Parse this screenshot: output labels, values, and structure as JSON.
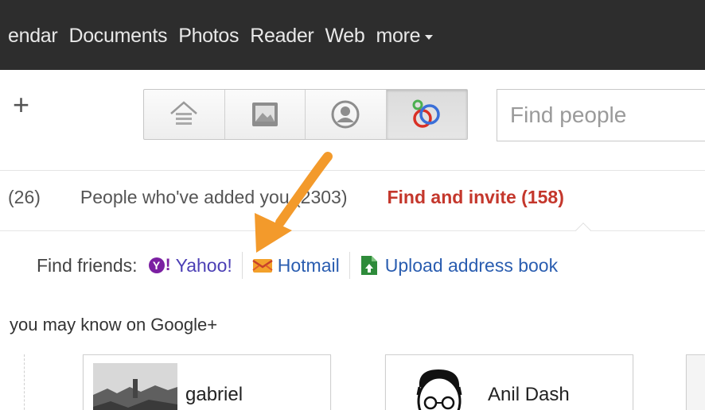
{
  "topnav": {
    "items": [
      "endar",
      "Documents",
      "Photos",
      "Reader",
      "Web"
    ],
    "more_label": "more"
  },
  "toolbar": {
    "plus_label": "+",
    "icons": [
      "home-icon",
      "photos-icon",
      "profile-icon",
      "circles-icon"
    ],
    "active_icon": "circles-icon",
    "search_placeholder": "Find people"
  },
  "tabs": {
    "partial_count": "(26)",
    "people_added": "People who've added you (2303)",
    "find_invite": "Find and invite (158)"
  },
  "find_friends": {
    "label": "Find friends:",
    "yahoo": "Yahoo!",
    "hotmail": "Hotmail",
    "upload": "Upload address book"
  },
  "suggestions": {
    "title": "you may know on Google+",
    "people": [
      "gabriel",
      "Anil Dash"
    ]
  },
  "colors": {
    "topbar_bg": "#2d2d2d",
    "tab_active": "#c4372c",
    "link": "#2a5db0",
    "arrow": "#f39a2b"
  }
}
